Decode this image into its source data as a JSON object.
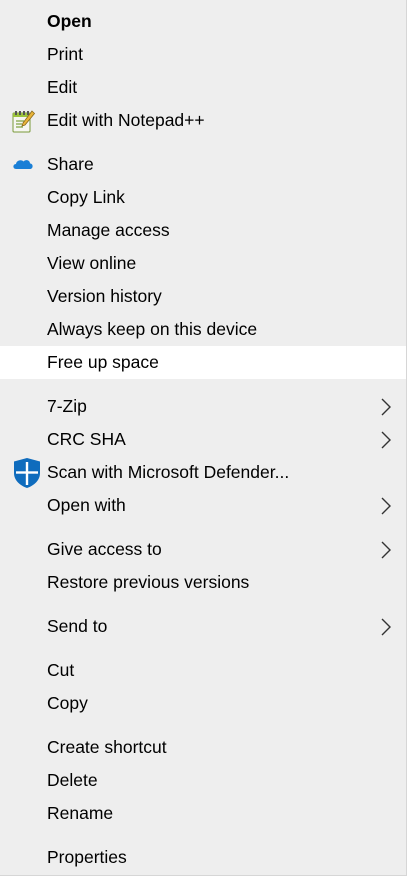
{
  "menu": {
    "items": [
      {
        "label": "Open"
      },
      {
        "label": "Print"
      },
      {
        "label": "Edit"
      },
      {
        "label": "Edit with Notepad++",
        "icon": "notepad-plus-plus-icon"
      },
      {
        "label": "Share",
        "icon": "onedrive-cloud-icon"
      },
      {
        "label": "Copy Link"
      },
      {
        "label": "Manage access"
      },
      {
        "label": "View online"
      },
      {
        "label": "Version history"
      },
      {
        "label": "Always keep on this device"
      },
      {
        "label": "Free up space",
        "highlighted": true
      },
      {
        "label": "7-Zip",
        "submenu": true
      },
      {
        "label": "CRC SHA",
        "submenu": true
      },
      {
        "label": "Scan with Microsoft Defender...",
        "icon": "microsoft-defender-shield-icon"
      },
      {
        "label": "Open with",
        "submenu": true
      },
      {
        "label": "Give access to",
        "submenu": true
      },
      {
        "label": "Restore previous versions"
      },
      {
        "label": "Send to",
        "submenu": true
      },
      {
        "label": "Cut"
      },
      {
        "label": "Copy"
      },
      {
        "label": "Create shortcut"
      },
      {
        "label": "Delete"
      },
      {
        "label": "Rename"
      },
      {
        "label": "Properties"
      }
    ]
  },
  "colors": {
    "menu_background": "#eeeeee",
    "highlight_background": "#ffffff",
    "text": "#000000",
    "onedrive_blue": "#1a7fd6",
    "defender_blue": "#0f6cbd"
  }
}
